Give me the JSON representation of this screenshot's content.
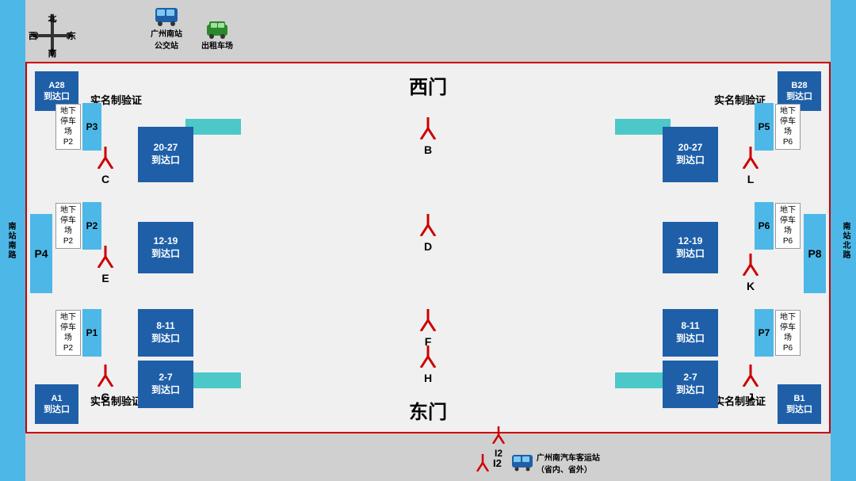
{
  "compass": {
    "west": "西",
    "north": "北",
    "south": "南",
    "east": "东"
  },
  "top_icons": {
    "bus_station_label": "广州南站\n公交站",
    "taxi_label": "出租车场"
  },
  "gate_labels": {
    "west_gate": "西门",
    "east_gate": "东门"
  },
  "arrival_blocks": {
    "a28": "A28\n到达口",
    "b28": "B28\n到达口",
    "a1": "A1\n到达口",
    "b1": "B1\n到达口",
    "left_upper": "20-27\n到达口",
    "left_mid": "12-19\n到达口",
    "left_lower1": "8-11\n到达口",
    "left_lower2": "2-7\n到达口",
    "right_upper": "20-27\n到达口",
    "right_mid": "12-19\n到达口",
    "right_lower1": "8-11\n到达口",
    "right_lower2": "2-7\n到达口"
  },
  "security_labels": {
    "top_left": "实名制验证",
    "top_right": "实名制验证",
    "bottom_left": "实名制验证",
    "bottom_right": "实名制验证"
  },
  "gate_symbols": {
    "B": "B",
    "C": "C",
    "D": "D",
    "E": "E",
    "F": "F",
    "G": "G",
    "H": "H",
    "I2": "I2",
    "J": "J",
    "K": "K",
    "L": "L"
  },
  "parking": {
    "p1": "P1",
    "p2": "P2",
    "p3": "P3",
    "p4": "P4",
    "p5": "P5",
    "p6": "P6",
    "p7": "P7",
    "p8": "P8",
    "p2_label": "地下\n停车场\nP2",
    "p6_label": "地下\n停车场\nP6"
  },
  "road_labels": {
    "left": "南站南路",
    "right": "南站北路"
  },
  "bottom_legend": {
    "gate_symbol": "Y",
    "gate_label": "I2",
    "bus_label": "广州南汽车客运站\n（省内、省外）"
  }
}
